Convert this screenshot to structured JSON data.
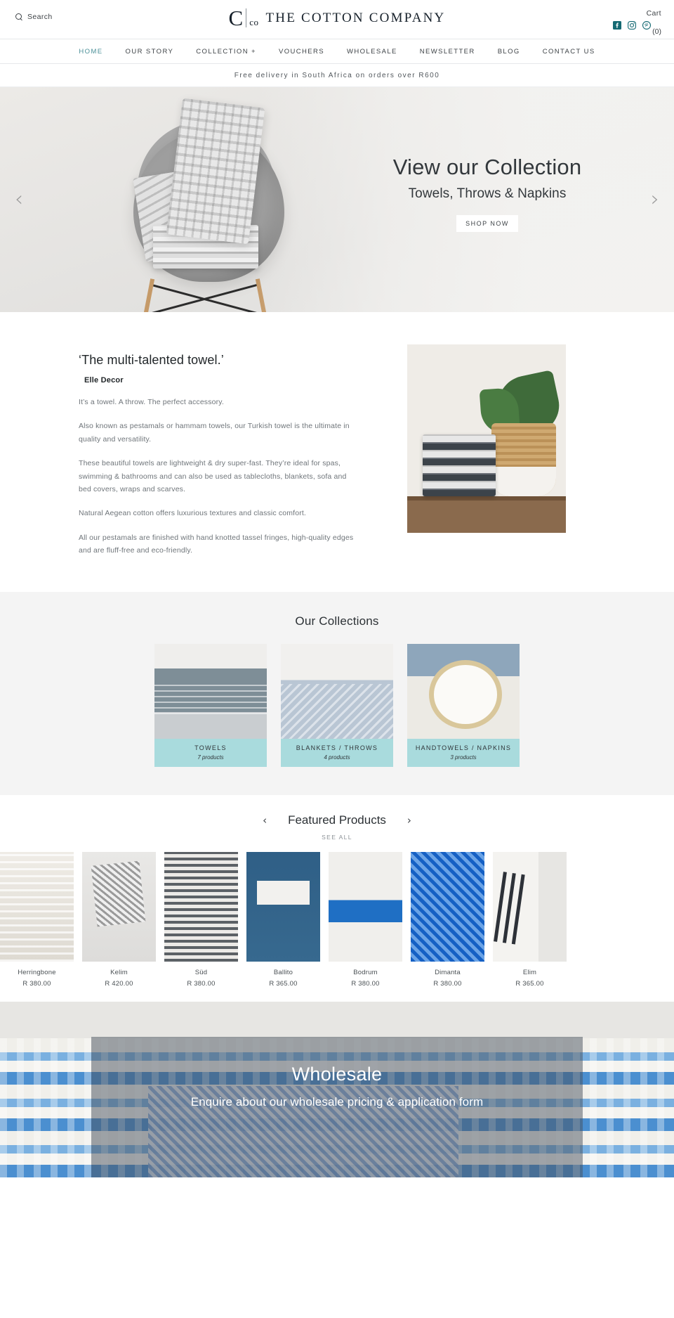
{
  "header": {
    "search_label": "Search",
    "logo_c": "C",
    "logo_co": "co",
    "logo_text": "THE COTTON COMPANY",
    "cart_label": "Cart",
    "cart_count": "(0)",
    "socials": [
      {
        "name": "facebook-icon",
        "label": "Facebook"
      },
      {
        "name": "instagram-icon",
        "label": "Instagram"
      },
      {
        "name": "pinterest-icon",
        "label": "Pinterest"
      }
    ]
  },
  "nav": {
    "items": [
      {
        "label": "HOME",
        "active": true
      },
      {
        "label": "OUR STORY",
        "active": false
      },
      {
        "label": "COLLECTION +",
        "active": false
      },
      {
        "label": "VOUCHERS",
        "active": false
      },
      {
        "label": "WHOLESALE",
        "active": false
      },
      {
        "label": "NEWSLETTER",
        "active": false
      },
      {
        "label": "BLOG",
        "active": false
      },
      {
        "label": "CONTACT US",
        "active": false
      }
    ]
  },
  "announcement": {
    "text": "Free delivery in South Africa on orders over R600"
  },
  "hero": {
    "title": "View our Collection",
    "subtitle": "Towels, Throws & Napkins",
    "button": "SHOP NOW",
    "prev_arrow": "‹",
    "next_arrow": "›"
  },
  "about": {
    "quote": "‘The multi-talented towel.’",
    "source": "Elle Decor",
    "paragraphs": [
      "It’s a towel.  A throw. The perfect accessory.",
      "Also known as pestamals or hammam towels, our Turkish towel is the ultimate in quality and versatility.",
      "These beautiful towels are lightweight & dry super-fast. They’re ideal for spas, swimming & bathrooms and can also be used as tablecloths, blankets, sofa and bed covers, wraps and scarves.",
      "Natural Aegean cotton offers luxurious textures and classic comfort.",
      "All our pestamals are finished with hand knotted tassel fringes, high-quality edges and are fluff-free and eco-friendly."
    ]
  },
  "collections": {
    "title": "Our Collections",
    "items": [
      {
        "name": "TOWELS",
        "count": "7 products"
      },
      {
        "name": "BLANKETS / THROWS",
        "count": "4 products"
      },
      {
        "name": "HANDTOWELS / NAPKINS",
        "count": "3 products"
      }
    ]
  },
  "featured": {
    "title": "Featured Products",
    "see_all": "SEE ALL",
    "prev_arrow": "‹",
    "next_arrow": "›",
    "products": [
      {
        "name": "Herringbone",
        "price": "R 380.00"
      },
      {
        "name": "Kelim",
        "price": "R 420.00"
      },
      {
        "name": "Süd",
        "price": "R 380.00"
      },
      {
        "name": "Ballito",
        "price": "R 365.00"
      },
      {
        "name": "Bodrum",
        "price": "R 380.00"
      },
      {
        "name": "Dimanta",
        "price": "R 380.00"
      },
      {
        "name": "Elim",
        "price": "R 365.00"
      }
    ]
  },
  "wholesale": {
    "title": "Wholesale",
    "subtitle": "Enquire about our wholesale pricing & application form"
  },
  "colors": {
    "accent_teal": "#4a8f97",
    "caption_teal": "#a9dbdd",
    "text_dark": "#3d4246",
    "text_muted": "#6f757a",
    "page_bg": "#ffffff",
    "section_bg": "#f4f4f4"
  }
}
